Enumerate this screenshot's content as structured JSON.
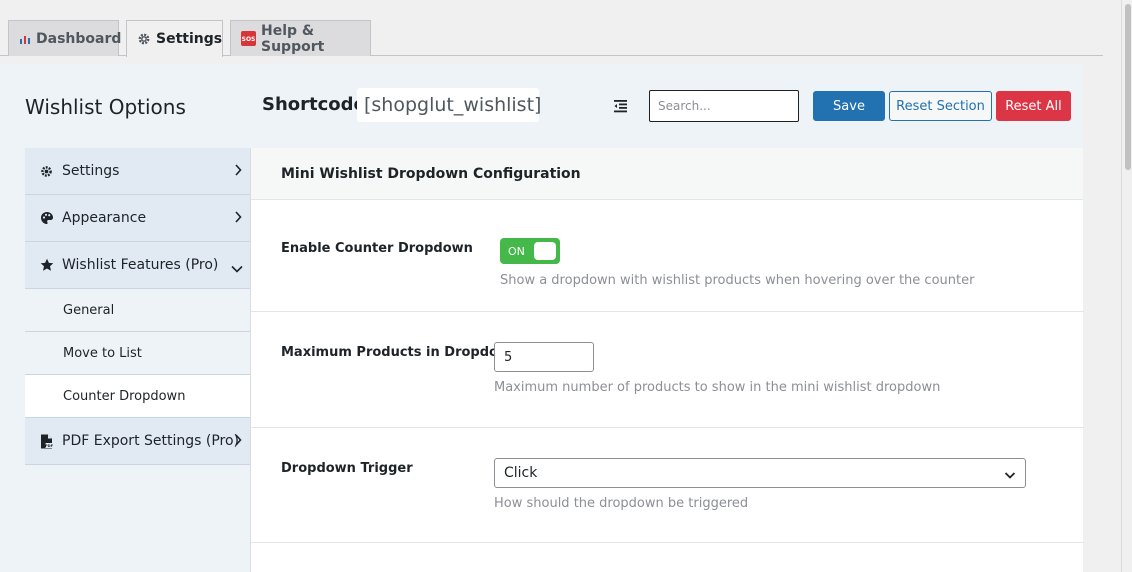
{
  "tabs": [
    {
      "label": "Dashboard",
      "icon": "bar-chart-icon"
    },
    {
      "label": "Settings",
      "icon": "gear-icon"
    },
    {
      "label": "Help & Support",
      "icon": "sos-icon"
    }
  ],
  "header": {
    "title": "Wishlist Options",
    "shortcode_label": "Shortcode:",
    "shortcode_value": "[shopglut_wishlist]",
    "search_placeholder": "Search...",
    "save_label": "Save",
    "reset_section_label": "Reset Section",
    "reset_all_label": "Reset All"
  },
  "sidebar": {
    "items": [
      {
        "label": "Settings",
        "icon": "gear-icon"
      },
      {
        "label": "Appearance",
        "icon": "palette-icon"
      },
      {
        "label": "Wishlist Features (Pro)",
        "icon": "star-icon"
      },
      {
        "label": "PDF Export Settings (Pro)",
        "icon": "pdf-file-icon"
      }
    ],
    "subitems": [
      "General",
      "Move to List",
      "Counter Dropdown"
    ],
    "active_subitem": "Counter Dropdown"
  },
  "content": {
    "section_title": "Mini Wishlist Dropdown Configuration",
    "fields": [
      {
        "label": "Enable Counter Dropdown",
        "toggle_text": "ON",
        "help": "Show a dropdown with wishlist products when hovering over the counter"
      },
      {
        "label": "Maximum Products in Dropdown",
        "value": "5",
        "help": "Maximum number of products to show in the mini wishlist dropdown"
      },
      {
        "label": "Dropdown Trigger",
        "value": "Click",
        "help": "How should the dropdown be triggered"
      }
    ]
  },
  "colors": {
    "primary": "#2271b1",
    "danger": "#dc3545",
    "toggle_on": "#44b849"
  }
}
